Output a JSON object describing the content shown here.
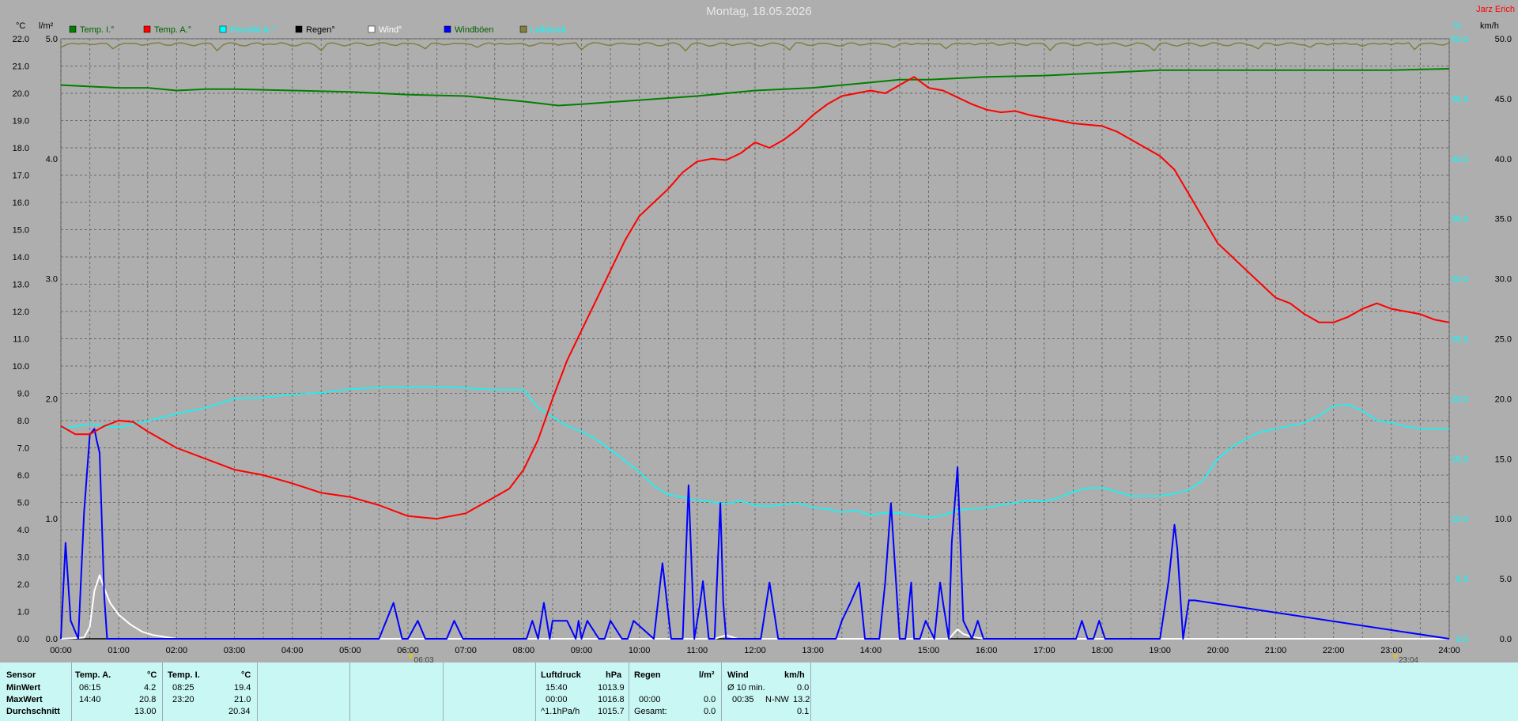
{
  "title": "Montag, 18.05.2026",
  "station": "Jarz Erich",
  "units": {
    "left1": "°C",
    "left2": "l/m²",
    "right1": "%",
    "right2": "km/h"
  },
  "colors": {
    "temp_inside": "#008000",
    "temp_outside": "#ff0000",
    "humidity": "#00ffff",
    "rain": "#000000",
    "wind": "#ffffff",
    "gusts": "#0000ff",
    "pressure": "#808040",
    "station": "#ff0000",
    "background": "#aeaeae"
  },
  "legend": [
    {
      "label": "Temp. I.°",
      "color": "#008000",
      "text_color": "#006000"
    },
    {
      "label": "Temp. A.°",
      "color": "#ff0000",
      "text_color": "#006000"
    },
    {
      "label": "Feuchte A.°",
      "color": "#00ffff",
      "text_color": "#00ffff"
    },
    {
      "label": "Regen°",
      "color": "#000000",
      "text_color": "#000000"
    },
    {
      "label": "Wind°",
      "color": "#ffffff",
      "text_color": "#ffffff"
    },
    {
      "label": "Windböen",
      "color": "#0000ff",
      "text_color": "#006000"
    },
    {
      "label": "Luftdruck",
      "color": "#808040",
      "text_color": "#00ffff"
    }
  ],
  "chart_data": {
    "type": "line",
    "title": "Montag, 18.05.2026",
    "x_ticks": [
      "00:00",
      "01:00",
      "02:00",
      "03:00",
      "04:00",
      "05:00",
      "06:00",
      "07:00",
      "08:00",
      "09:00",
      "10:00",
      "11:00",
      "12:00",
      "13:00",
      "14:00",
      "15:00",
      "16:00",
      "17:00",
      "18:00",
      "19:00",
      "20:00",
      "21:00",
      "22:00",
      "23:00",
      "24:00"
    ],
    "xlim": [
      0,
      24
    ],
    "temp_axis": {
      "unit": "°C",
      "ylim": [
        0,
        22
      ],
      "ticks": [
        "0.0",
        "1.0",
        "2.0",
        "3.0",
        "4.0",
        "5.0",
        "6.0",
        "7.0",
        "8.0",
        "9.0",
        "10.0",
        "11.0",
        "12.0",
        "13.0",
        "14.0",
        "15.0",
        "16.0",
        "17.0",
        "18.0",
        "19.0",
        "20.0",
        "21.0",
        "22.0"
      ]
    },
    "rain_axis": {
      "unit": "l/m²",
      "ylim": [
        0,
        5
      ],
      "ticks": [
        "0.0",
        "1.0",
        "2.0",
        "3.0",
        "4.0",
        "5.0"
      ]
    },
    "wind_axis": {
      "unit": "km/h",
      "ylim": [
        0,
        50
      ],
      "ticks": [
        "0.0",
        "5.0",
        "10.0",
        "15.0",
        "20.0",
        "25.0",
        "30.0",
        "35.0",
        "40.0",
        "45.0",
        "50.0"
      ]
    },
    "sun_markers": [
      {
        "label": "06:03",
        "x": 6.05
      },
      {
        "label": "23:04",
        "x": 23.07
      }
    ],
    "series": [
      {
        "name": "Temp. I.°",
        "axis": "temp",
        "color": "#008000",
        "x": [
          0,
          0.5,
          1,
          1.5,
          2,
          2.5,
          3,
          4,
          5,
          6,
          7,
          8,
          8.6,
          9,
          10,
          11,
          12,
          13,
          14,
          14.5,
          15,
          16,
          17,
          18,
          19,
          20,
          21,
          22,
          23,
          24
        ],
        "y": [
          20.3,
          20.25,
          20.2,
          20.2,
          20.1,
          20.15,
          20.15,
          20.1,
          20.05,
          19.95,
          19.9,
          19.7,
          19.55,
          19.6,
          19.75,
          19.9,
          20.1,
          20.2,
          20.4,
          20.5,
          20.5,
          20.6,
          20.65,
          20.75,
          20.85,
          20.85,
          20.85,
          20.85,
          20.85,
          20.9
        ]
      },
      {
        "name": "Temp. A.°",
        "axis": "temp",
        "color": "#ff0000",
        "x": [
          0,
          0.25,
          0.5,
          0.75,
          1,
          1.25,
          1.5,
          2,
          2.5,
          3,
          3.5,
          4,
          4.5,
          5,
          5.5,
          6,
          6.5,
          7,
          7.5,
          7.75,
          8,
          8.25,
          8.5,
          8.75,
          9,
          9.25,
          9.5,
          9.75,
          10,
          10.25,
          10.5,
          10.75,
          11,
          11.25,
          11.5,
          11.75,
          12,
          12.25,
          12.5,
          12.75,
          13,
          13.25,
          13.5,
          13.75,
          14,
          14.25,
          14.5,
          14.75,
          15,
          15.25,
          15.5,
          15.75,
          16,
          16.25,
          16.5,
          16.75,
          17,
          17.25,
          17.5,
          17.75,
          18,
          18.25,
          18.5,
          18.75,
          19,
          19.25,
          19.5,
          19.75,
          20,
          20.25,
          20.5,
          20.75,
          21,
          21.25,
          21.5,
          21.75,
          22,
          22.25,
          22.5,
          22.75,
          23,
          23.25,
          23.5,
          23.75,
          24
        ],
        "y": [
          7.8,
          7.5,
          7.5,
          7.8,
          8.0,
          7.95,
          7.6,
          7.0,
          6.6,
          6.2,
          6.0,
          5.7,
          5.35,
          5.2,
          4.9,
          4.5,
          4.4,
          4.6,
          5.2,
          5.5,
          6.2,
          7.3,
          8.8,
          10.2,
          11.3,
          12.4,
          13.5,
          14.6,
          15.5,
          16.0,
          16.5,
          17.1,
          17.5,
          17.6,
          17.55,
          17.8,
          18.2,
          18.0,
          18.3,
          18.7,
          19.2,
          19.6,
          19.9,
          20.0,
          20.1,
          20.0,
          20.3,
          20.6,
          20.2,
          20.1,
          19.85,
          19.6,
          19.4,
          19.3,
          19.35,
          19.2,
          19.1,
          19.0,
          18.9,
          18.85,
          18.8,
          18.6,
          18.3,
          18.0,
          17.7,
          17.2,
          16.3,
          15.4,
          14.5,
          14.0,
          13.5,
          13.0,
          12.5,
          12.3,
          11.9,
          11.6,
          11.6,
          11.8,
          12.1,
          12.3,
          12.1,
          12.0,
          11.9,
          11.7,
          11.6
        ]
      },
      {
        "name": "Feuchte A.°",
        "axis": "humidity",
        "color": "#00ffff",
        "x": [
          0,
          0.5,
          1,
          1.5,
          2,
          2.5,
          3,
          3.5,
          4,
          4.5,
          5,
          5.5,
          6,
          6.5,
          7,
          7.5,
          8,
          8.25,
          8.5,
          8.75,
          9,
          9.25,
          9.5,
          9.75,
          10,
          10.25,
          10.5,
          10.75,
          11,
          11.25,
          11.5,
          11.75,
          12,
          12.25,
          12.5,
          12.75,
          13,
          13.25,
          13.5,
          13.75,
          14,
          14.25,
          14.5,
          14.75,
          15,
          15.25,
          15.5,
          15.75,
          16,
          16.25,
          16.5,
          16.75,
          17,
          17.25,
          17.5,
          17.75,
          18,
          18.25,
          18.5,
          18.75,
          19,
          19.25,
          19.5,
          19.75,
          20,
          20.25,
          20.5,
          20.75,
          21,
          21.25,
          21.5,
          21.75,
          22,
          22.25,
          22.5,
          22.75,
          23,
          23.25,
          23.5,
          23.75,
          24
        ],
        "y": [
          35.0,
          35.8,
          35.2,
          36.3,
          37.5,
          38.5,
          40.0,
          40.2,
          40.7,
          41.0,
          41.6,
          41.9,
          42.0,
          42.0,
          41.8,
          41.5,
          41.5,
          38.5,
          37.0,
          35.5,
          34.5,
          33.3,
          31.5,
          29.7,
          27.8,
          25.5,
          24.0,
          23.6,
          23.1,
          22.8,
          22.5,
          23.0,
          22.2,
          22.1,
          22.4,
          22.6,
          21.9,
          21.6,
          21.1,
          21.4,
          20.6,
          21.0,
          20.9,
          20.6,
          20.1,
          20.6,
          21.4,
          21.7,
          21.8,
          22.3,
          22.7,
          23.1,
          22.9,
          23.5,
          24.5,
          25.1,
          25.2,
          24.5,
          23.8,
          23.8,
          23.8,
          24.2,
          24.8,
          26.5,
          30.0,
          32.0,
          33.4,
          34.5,
          35.0,
          35.5,
          36.0,
          37.2,
          38.8,
          39.0,
          38.0,
          36.4,
          36.0,
          35.4,
          35.0,
          35.0,
          35.0
        ]
      },
      {
        "name": "Regen°",
        "axis": "rain",
        "color": "#000000",
        "x": [
          0,
          24
        ],
        "y": [
          0,
          0
        ]
      },
      {
        "name": "Wind°",
        "axis": "wind",
        "color": "#ffffff",
        "x": [
          0,
          0.4,
          0.5,
          0.58,
          0.67,
          0.75,
          0.85,
          1,
          1.2,
          1.4,
          1.6,
          2,
          2.5,
          11.3,
          11.5,
          11.7,
          15.35,
          15.5,
          15.6,
          15.8,
          16,
          24
        ],
        "y": [
          0,
          0.1,
          1.0,
          4.0,
          5.3,
          4.2,
          3.0,
          2.0,
          1.2,
          0.6,
          0.3,
          0,
          0,
          0,
          0.3,
          0,
          0,
          0.8,
          0.4,
          0.1,
          0,
          0
        ]
      },
      {
        "name": "Windböen",
        "axis": "wind",
        "color": "#0000ff",
        "x": [
          0,
          0.08,
          0.17,
          0.3,
          0.4,
          0.5,
          0.58,
          0.62,
          0.67,
          0.75,
          0.8,
          0.9,
          5.5,
          5.75,
          5.9,
          6.0,
          6.17,
          6.3,
          6.67,
          6.8,
          6.95,
          8.05,
          8.15,
          8.25,
          8.35,
          8.45,
          8.5,
          8.6,
          8.75,
          8.9,
          8.95,
          9.0,
          9.1,
          9.3,
          9.4,
          9.5,
          9.7,
          9.8,
          9.9,
          10.25,
          10.4,
          10.55,
          10.75,
          10.85,
          10.95,
          11.05,
          11.1,
          11.2,
          11.3,
          11.4,
          11.45,
          11.5,
          11.55,
          11.6,
          11.65,
          11.75,
          12.1,
          12.25,
          12.4,
          13.4,
          13.5,
          13.65,
          13.8,
          13.9,
          14.15,
          14.25,
          14.35,
          14.5,
          14.6,
          14.7,
          14.75,
          14.85,
          14.95,
          15.1,
          15.2,
          15.25,
          15.35,
          15.4,
          15.5,
          15.6,
          15.75,
          15.85,
          15.95,
          16.05,
          17.55,
          17.65,
          17.75,
          17.85,
          17.95,
          18.05,
          19.0,
          19.15,
          19.25,
          19.3,
          19.4,
          19.5,
          19.6,
          24
        ],
        "y": [
          0,
          8.0,
          1.5,
          0,
          10.5,
          17.0,
          17.5,
          16.5,
          15.5,
          3.5,
          0,
          0,
          0,
          3.0,
          0,
          0,
          1.5,
          0,
          0,
          1.5,
          0,
          0,
          1.5,
          0,
          3.0,
          0,
          1.5,
          1.5,
          1.5,
          0,
          1.5,
          0,
          1.5,
          0,
          0,
          1.5,
          0,
          0,
          1.5,
          0,
          6.3,
          0,
          0,
          12.8,
          0,
          3.0,
          4.8,
          0,
          0,
          11.3,
          3.0,
          0,
          0,
          0,
          0,
          0,
          0,
          4.7,
          0,
          0,
          1.5,
          3.0,
          4.7,
          0,
          0,
          4.7,
          11.3,
          0,
          0,
          4.7,
          0,
          0,
          1.5,
          0,
          4.7,
          3.0,
          0,
          8.0,
          14.3,
          1.5,
          0,
          1.5,
          0,
          0,
          0,
          1.5,
          0,
          0,
          1.5,
          0,
          0,
          4.8,
          9.5,
          7.5,
          0,
          3.2,
          3.2,
          0
        ]
      },
      {
        "name": "Luftdruck",
        "axis": "pressure",
        "color": "#808040",
        "x": [
          0,
          24
        ],
        "y": [
          1015.7,
          1015.7
        ]
      }
    ]
  },
  "footer": {
    "col_sensor": {
      "head": "Sensor",
      "rows": [
        "MinWert",
        "MaxWert",
        "Durchschnitt"
      ]
    },
    "col_tempa": {
      "head": "Temp. A.",
      "unit": "°C",
      "min_time": "06:15",
      "min_val": "4.2",
      "max_time": "14:40",
      "max_val": "20.8",
      "avg_val": "13.00"
    },
    "col_tempi": {
      "head": "Temp. I.",
      "unit": "°C",
      "min_time": "08:25",
      "min_val": "19.4",
      "max_time": "23:20",
      "max_val": "21.0",
      "avg_val": "20.34"
    },
    "col_druck": {
      "head": "Luftdruck",
      "unit": "hPa",
      "min_time": "15:40",
      "min_val": "1013.9",
      "max_time": "00:00",
      "max_val": "1016.8",
      "trend_label": "^1.1hPa/h",
      "trend_val": "1015.7"
    },
    "col_regen": {
      "head": "Regen",
      "unit": "l/m²",
      "row1_val": "",
      "max_time": "00:00",
      "max_val": "0.0",
      "total_label": "Gesamt:",
      "total_val": "0.0",
      "min_val": "0.0"
    },
    "col_wind": {
      "head": "Wind",
      "unit": "km/h",
      "avg_label": "Ø 10 min.",
      "avg_val": "0.0",
      "max_time": "00:35",
      "max_dir": "N-NW",
      "max_val": "13.2",
      "day_avg": "0.1"
    }
  }
}
